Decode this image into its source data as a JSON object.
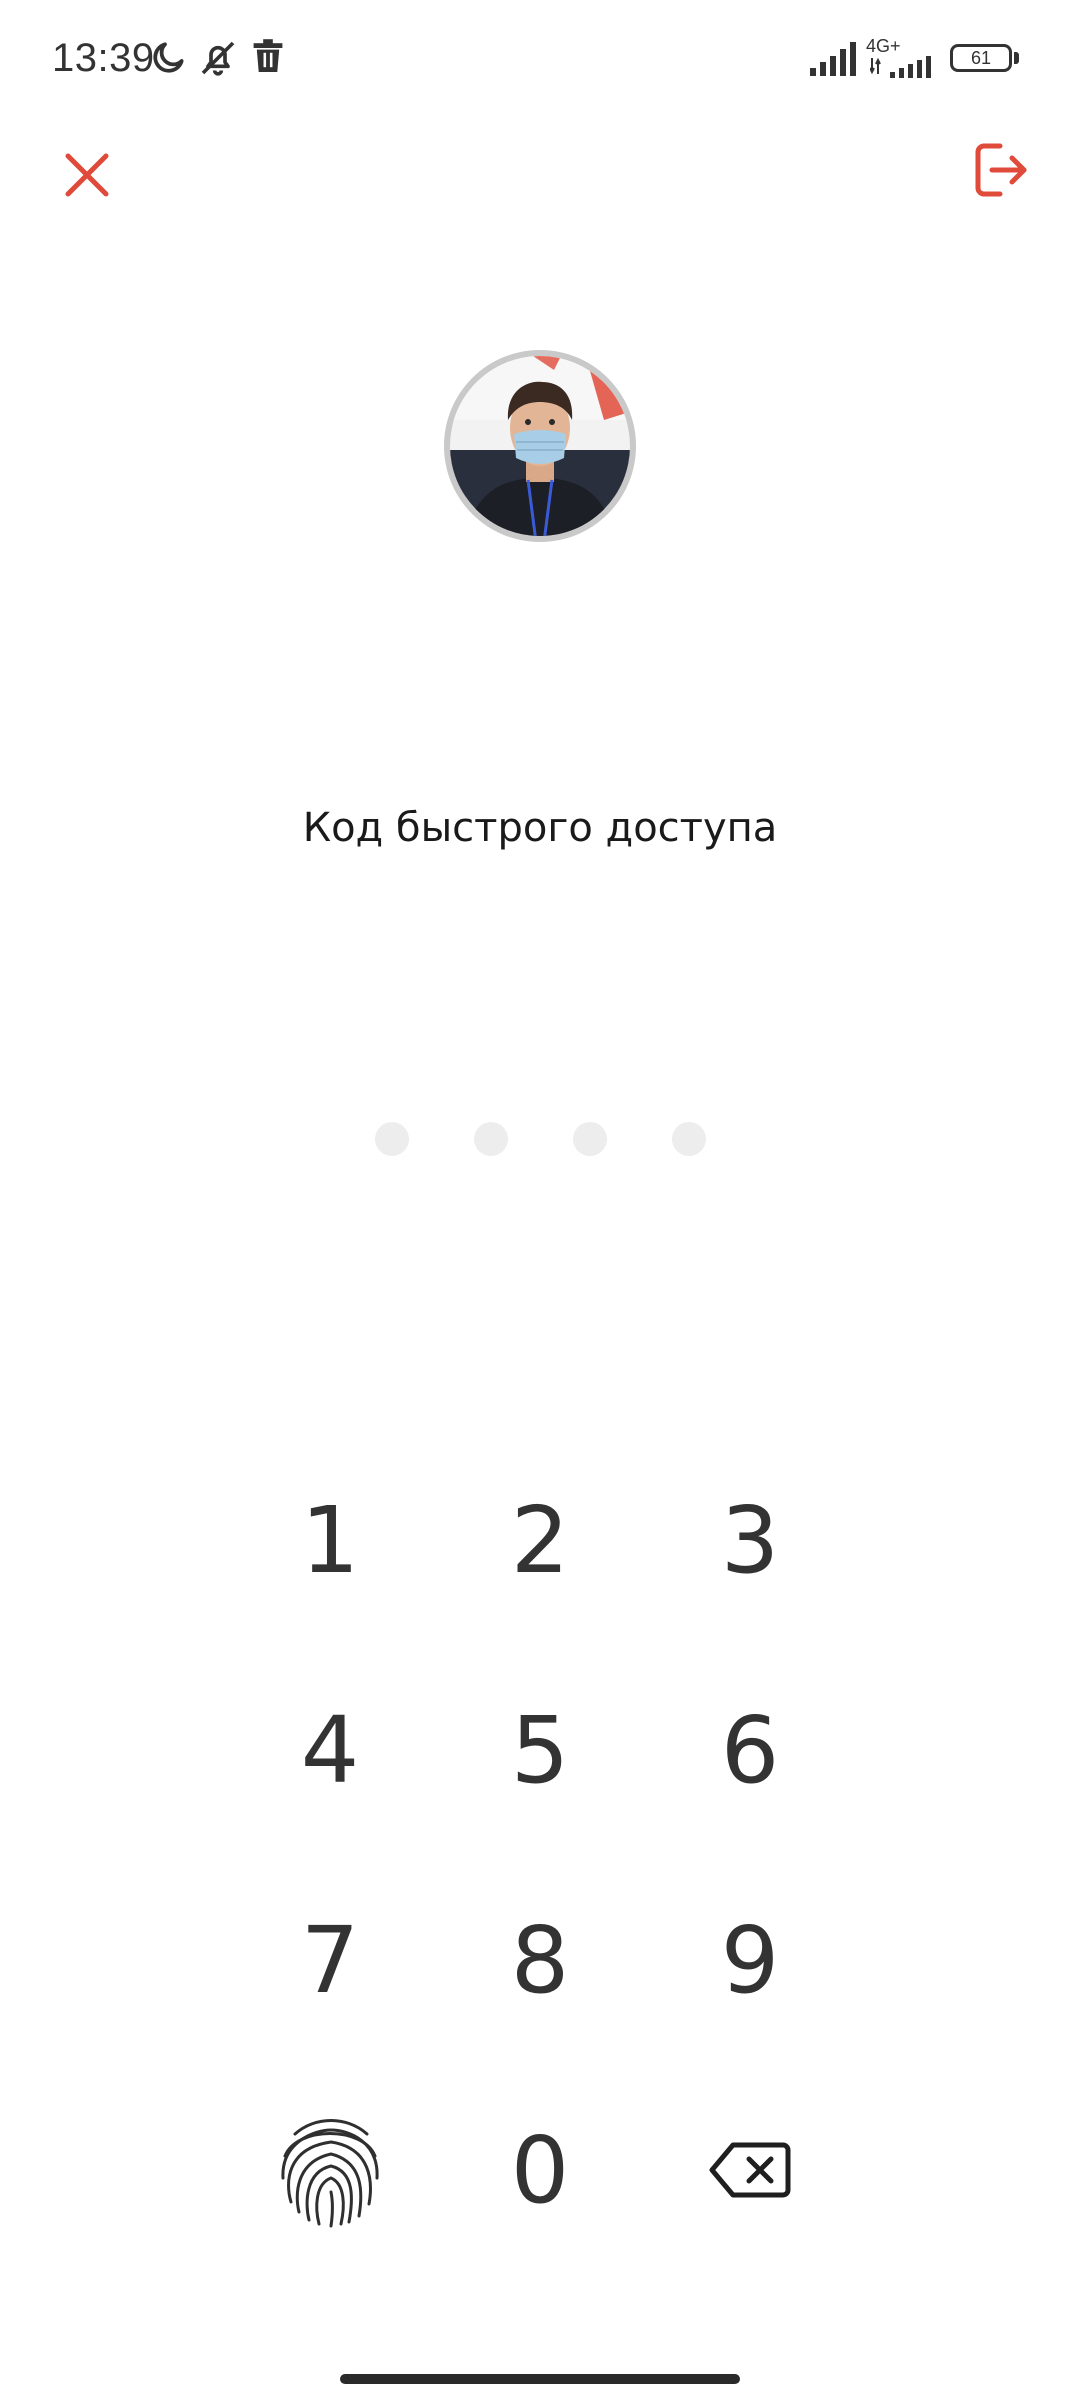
{
  "status_bar": {
    "time": "13:39",
    "network_type": "4G+",
    "battery_level": "61",
    "icons": [
      "moon-icon",
      "bell-off-icon",
      "trash-icon",
      "signal-icon",
      "signal-icon",
      "battery-icon"
    ]
  },
  "header": {
    "close_icon": "close-icon",
    "logout_icon": "logout-icon"
  },
  "colors": {
    "accent": "#e04a3a",
    "digit": "#333333",
    "dot_empty": "#ededed"
  },
  "profile": {
    "avatar_icon": "user-avatar"
  },
  "pin": {
    "title": "Код быстрого доступа",
    "length": 4,
    "entered": 0
  },
  "keypad": {
    "keys": [
      "1",
      "2",
      "3",
      "4",
      "5",
      "6",
      "7",
      "8",
      "9",
      "0"
    ],
    "fingerprint_icon": "fingerprint-icon",
    "backspace_icon": "backspace-icon"
  }
}
